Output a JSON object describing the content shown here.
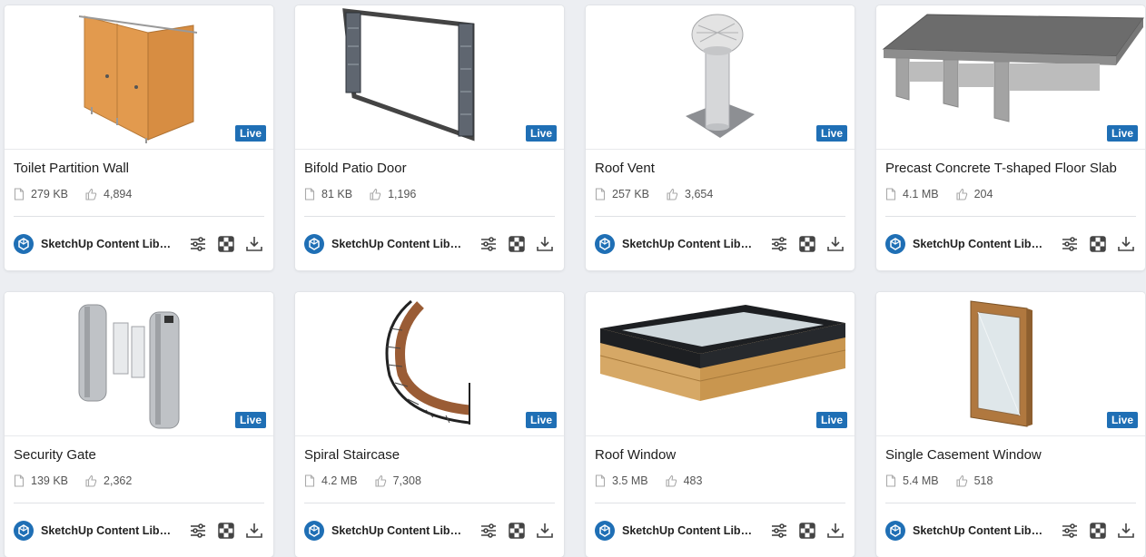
{
  "accent_color": "#1f6fb5",
  "cards": [
    {
      "title": "Toilet Partition Wall",
      "size": "279 KB",
      "likes": "4,894",
      "badge": "Live",
      "publisher": "SketchUp Content Libr...",
      "thumb_icon": "toilet-partition-model"
    },
    {
      "title": "Bifold Patio Door",
      "size": "81 KB",
      "likes": "1,196",
      "badge": "Live",
      "publisher": "SketchUp Content Libr...",
      "thumb_icon": "bifold-door-model"
    },
    {
      "title": "Roof Vent",
      "size": "257 KB",
      "likes": "3,654",
      "badge": "Live",
      "publisher": "SketchUp Content Libr...",
      "thumb_icon": "roof-vent-model"
    },
    {
      "title": "Precast Concrete T-shaped Floor Slab",
      "size": "4.1 MB",
      "likes": "204",
      "badge": "Live",
      "publisher": "SketchUp Content Libr...",
      "thumb_icon": "floor-slab-model"
    },
    {
      "title": "Security Gate",
      "size": "139 KB",
      "likes": "2,362",
      "badge": "Live",
      "publisher": "SketchUp Content Libr...",
      "thumb_icon": "security-gate-model"
    },
    {
      "title": "Spiral Staircase",
      "size": "4.2 MB",
      "likes": "7,308",
      "badge": "Live",
      "publisher": "SketchUp Content Libr...",
      "thumb_icon": "spiral-staircase-model"
    },
    {
      "title": "Roof Window",
      "size": "3.5 MB",
      "likes": "483",
      "badge": "Live",
      "publisher": "SketchUp Content Libr...",
      "thumb_icon": "roof-window-model"
    },
    {
      "title": "Single Casement Window",
      "size": "5.4 MB",
      "likes": "518",
      "badge": "Live",
      "publisher": "SketchUp Content Libr...",
      "thumb_icon": "casement-window-model"
    }
  ]
}
